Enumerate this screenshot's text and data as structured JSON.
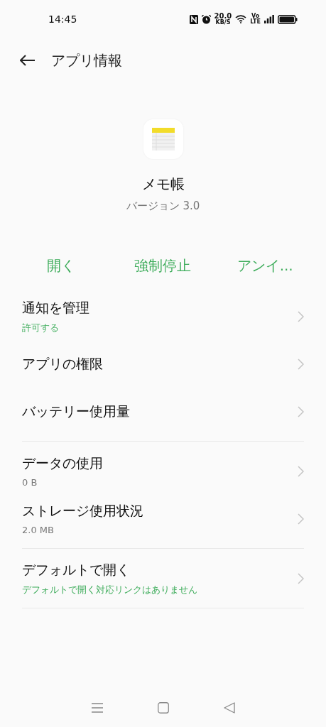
{
  "status_bar": {
    "time": "14:45",
    "speed_value": "20.0",
    "speed_unit": "KB/S",
    "volte_top": "Vo",
    "volte_bottom": "LTE"
  },
  "header": {
    "title": "アプリ情報"
  },
  "app": {
    "name": "メモ帳",
    "version": "バージョン 3.0"
  },
  "actions": [
    "開く",
    "強制停止",
    "アンイ..."
  ],
  "sections": [
    {
      "items": [
        {
          "title": "通知を管理",
          "subtitle": "許可する",
          "accent": true
        },
        {
          "title": "アプリの権限"
        },
        {
          "title": "バッテリー使用量"
        }
      ]
    },
    {
      "items": [
        {
          "title": "データの使用",
          "subtitle": "0 B",
          "accent": false
        },
        {
          "title": "ストレージ使用状況",
          "subtitle": "2.0 MB",
          "accent": false
        }
      ]
    },
    {
      "items": [
        {
          "title": "デフォルトで開く",
          "subtitle": "デフォルトで開く対応リンクはありません",
          "accent": true
        }
      ]
    }
  ]
}
